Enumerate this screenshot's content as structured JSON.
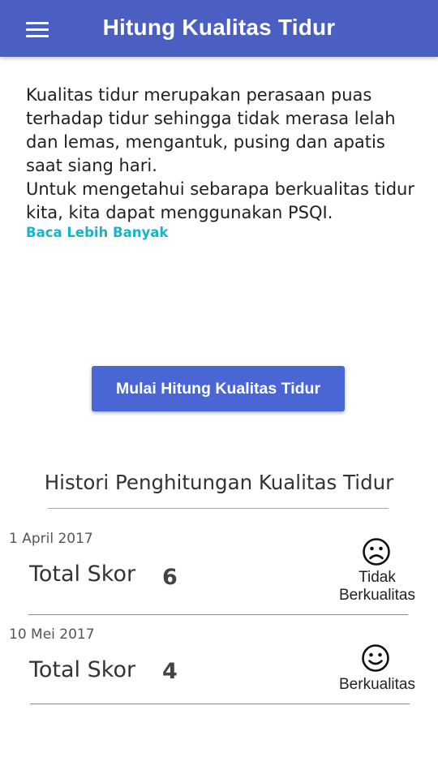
{
  "app_bar": {
    "title": "Hitung Kualitas Tidur",
    "menu_icon": "menu-icon"
  },
  "intro": {
    "paragraph1": "Kualitas tidur merupakan perasaan puas terhadap tidur sehingga tidak merasa lelah dan lemas, mengantuk, pusing dan apatis saat siang hari.",
    "paragraph2": "Untuk mengetahui sebarapa berkualitas tidur kita, kita dapat menggunakan PSQI.",
    "read_more": "Baca Lebih Banyak"
  },
  "start_button": {
    "label": "Mulai Hitung Kualitas Tidur"
  },
  "history": {
    "title": "Histori Penghitungan Kualitas Tidur",
    "entries": [
      {
        "date": "1 April 2017",
        "label": "Total Skor",
        "score": "6",
        "status_line1": "Tidak",
        "status_line2": "Berkualitas",
        "icon": "sad-face-icon"
      },
      {
        "date": "10 Mei 2017",
        "label": "Total Skor",
        "score": "4",
        "status_line1": "Berkualitas",
        "icon": "happy-face-icon"
      }
    ]
  },
  "colors": {
    "app_bar": "#4a5fc1",
    "button": "#4a66d4",
    "link": "#16b4c8"
  }
}
